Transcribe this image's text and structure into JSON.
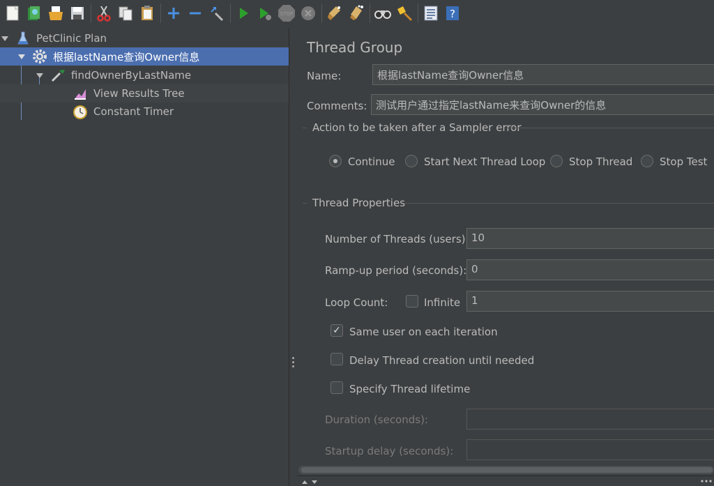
{
  "toolbar": {
    "buttons": [
      "new-icon",
      "templates-icon",
      "open-icon",
      "save-icon",
      "cut-icon",
      "copy-icon",
      "paste-icon",
      "expand-icon",
      "collapse-icon",
      "toggle-icon",
      "start-icon",
      "start-no-pause-icon",
      "stop-icon",
      "shutdown-icon",
      "clear-icon",
      "clear-all-icon",
      "search-icon",
      "reset-search-icon",
      "function-helper-icon",
      "help-icon"
    ]
  },
  "tree": {
    "plan": "PetClinic Plan",
    "thread_group": "根据lastName查询Owner信息",
    "sampler": "findOwnerByLastName",
    "listener": "View Results Tree",
    "timer": "Constant Timer"
  },
  "panel": {
    "title": "Thread Group",
    "name_label": "Name:",
    "name_value": "根据lastName查询Owner信息",
    "comments_label": "Comments:",
    "comments_value": "测试用户通过指定lastName来查询Owner的信息",
    "error_action_title": "Action to be taken after a Sampler error",
    "error_actions": [
      "Continue",
      "Start Next Thread Loop",
      "Stop Thread",
      "Stop Test"
    ],
    "error_action_selected": "Continue",
    "thread_props_title": "Thread Properties",
    "threads_label": "Number of Threads (users):",
    "threads_value": "10",
    "rampup_label": "Ramp-up period (seconds):",
    "rampup_value": "0",
    "loop_label": "Loop Count:",
    "infinite_label": "Infinite",
    "loop_value": "1",
    "same_user_label": "Same user on each iteration",
    "same_user_checked": true,
    "delay_label": "Delay Thread creation until needed",
    "lifetime_label": "Specify Thread lifetime",
    "duration_label": "Duration (seconds):",
    "startup_label": "Startup delay (seconds):"
  },
  "colors": {
    "background": "#3c3f41",
    "selection": "#4b6eaf",
    "text": "#bbbbbb",
    "field": "#45494a"
  }
}
